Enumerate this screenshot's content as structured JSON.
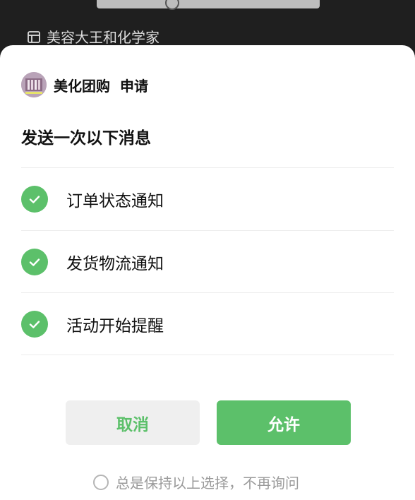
{
  "background": {
    "store_name": "美容大王和化学家",
    "store_icon": "storefront-icon"
  },
  "sheet": {
    "app_name": "美化团购",
    "action": "申请",
    "title": "发送一次以下消息",
    "items": [
      {
        "label": "订单状态通知",
        "checked": true,
        "icon": "check-circle-icon"
      },
      {
        "label": "发货物流通知",
        "checked": true,
        "icon": "check-circle-icon"
      },
      {
        "label": "活动开始提醒",
        "checked": true,
        "icon": "check-circle-icon"
      }
    ],
    "cancel_label": "取消",
    "allow_label": "允许",
    "remember_label": "总是保持以上选择，不再询问",
    "remember_checked": false
  },
  "colors": {
    "accent": "#5cc06a",
    "sheet_bg": "#ffffff",
    "overlay_bg": "#1f1f1f"
  }
}
